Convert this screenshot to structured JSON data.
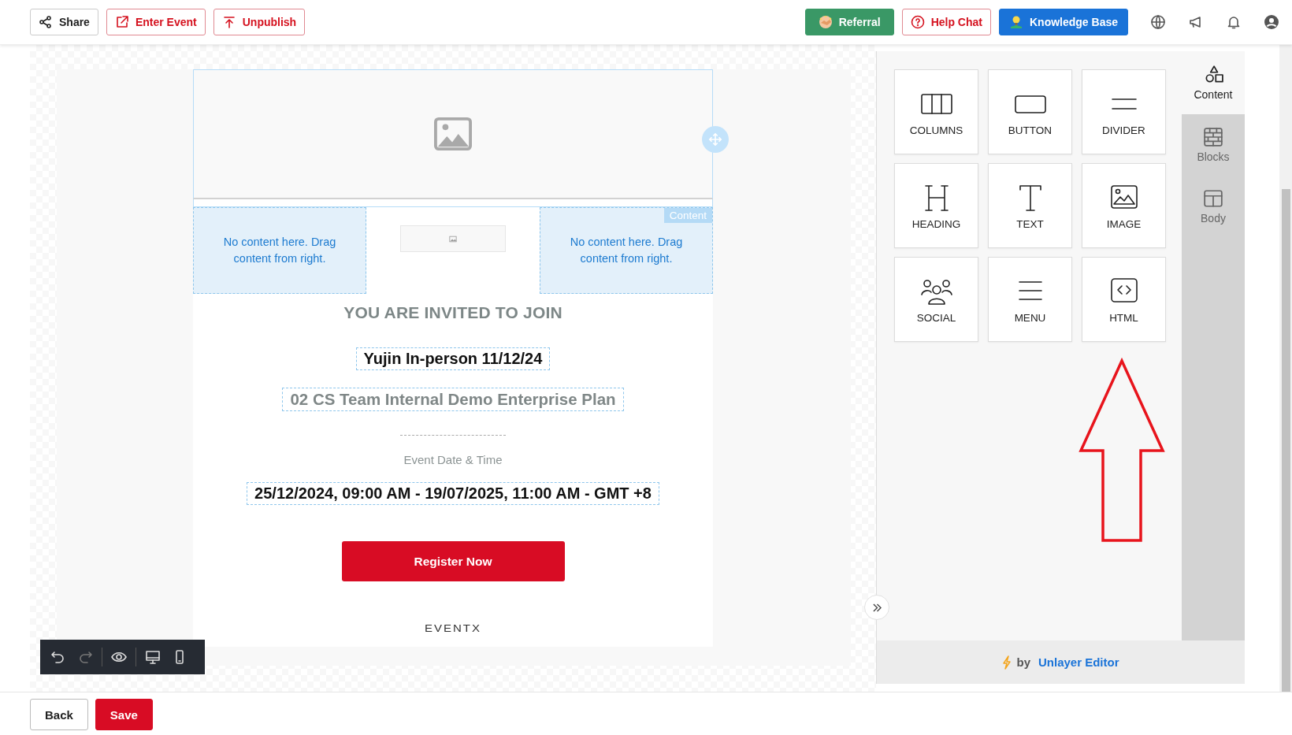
{
  "top_bar": {
    "left_buttons": [
      {
        "label": "Share",
        "kind": "share"
      },
      {
        "label": "Enter Event",
        "kind": "enter"
      },
      {
        "label": "Unpublish",
        "kind": "unpublish"
      }
    ],
    "right_buttons": [
      {
        "label": "Referral",
        "kind": "referral"
      },
      {
        "label": "Help Chat",
        "kind": "help"
      },
      {
        "label": "Knowledge Base",
        "kind": "knowledge"
      }
    ]
  },
  "email": {
    "columns": [
      {
        "kind": "empty",
        "text": "No content here. Drag content from right."
      },
      {
        "kind": "image"
      },
      {
        "kind": "empty",
        "text": "No content here. Drag content from right.",
        "tag": "Content"
      }
    ],
    "heading": "YOU ARE INVITED TO JOIN",
    "event_name": "Yujin In-person 11/12/24",
    "organizer": "02 CS Team Internal Demo Enterprise Plan",
    "date_label": "Event Date & Time",
    "date_value": "25/12/2024, 09:00 AM - 19/07/2025, 11:00 AM - GMT +8",
    "register_button": "Register Now",
    "logo": "EVENTX"
  },
  "tools": [
    {
      "label": "COLUMNS",
      "kind": "columns"
    },
    {
      "label": "BUTTON",
      "kind": "button"
    },
    {
      "label": "DIVIDER",
      "kind": "divider"
    },
    {
      "label": "HEADING",
      "kind": "heading"
    },
    {
      "label": "TEXT",
      "kind": "text"
    },
    {
      "label": "IMAGE",
      "kind": "image"
    },
    {
      "label": "SOCIAL",
      "kind": "social"
    },
    {
      "label": "MENU",
      "kind": "menu"
    },
    {
      "label": "HTML",
      "kind": "html"
    }
  ],
  "panel_tabs": [
    {
      "label": "Content",
      "kind": "content",
      "selected": true
    },
    {
      "label": "Blocks",
      "kind": "blocks",
      "selected": false
    },
    {
      "label": "Body",
      "kind": "body",
      "selected": false
    }
  ],
  "footer": {
    "by": "by",
    "link": "Unlayer Editor"
  },
  "bottom_bar": {
    "buttons": [
      {
        "label": "Back",
        "kind": "secondary"
      },
      {
        "label": "Save",
        "kind": "primary"
      }
    ]
  }
}
